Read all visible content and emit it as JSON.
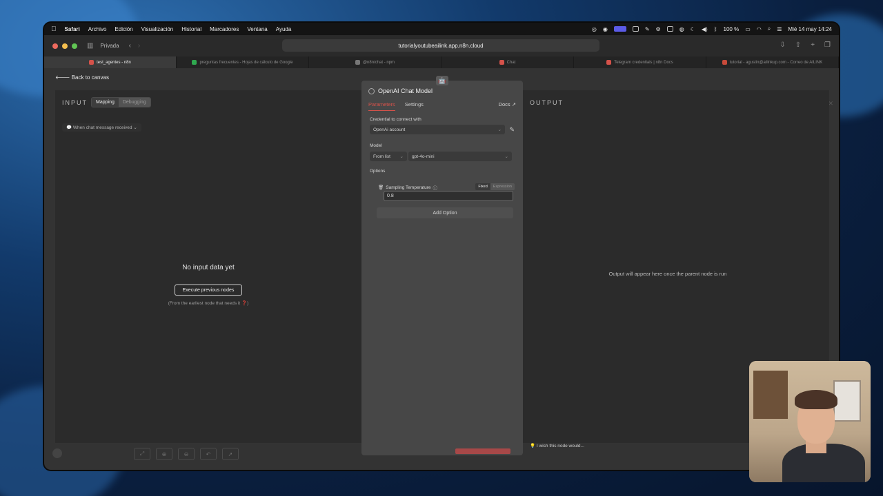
{
  "menubar": {
    "app": "Safari",
    "items": [
      "Archivo",
      "Edición",
      "Visualización",
      "Historial",
      "Marcadores",
      "Ventana",
      "Ayuda"
    ],
    "battery": "100 %",
    "clock": "Mié 14 may 14:24"
  },
  "browser": {
    "private_label": "Privada",
    "url": "tutorialyoutubeailink.app.n8n.cloud",
    "tabs": [
      {
        "label": "test_agentes - n8n",
        "active": true,
        "color": "#d5524a"
      },
      {
        "label": "preguntas frecuentes - Hojas de cálculo de Google",
        "active": false,
        "color": "#2fa84f"
      },
      {
        "label": "@n8n/chat - npm",
        "active": false,
        "color": "#777777"
      },
      {
        "label": "Chat",
        "active": false,
        "color": "#d5524a"
      },
      {
        "label": "Telegram credentials | n8n Docs",
        "active": false,
        "color": "#d5524a"
      },
      {
        "label": "tutorial - agustin@ailinkup.com - Correo de AILINK",
        "active": false,
        "color": "#c84a3a"
      }
    ]
  },
  "app": {
    "back_label": "Back to canvas",
    "input": {
      "title": "INPUT",
      "mapping_label": "Mapping",
      "debugging_label": "Debugging",
      "trigger_label": "When chat message received",
      "empty_title": "No input data yet",
      "execute_label": "Execute previous nodes",
      "hint": "(From the earliest node that needs it ❓)"
    },
    "output": {
      "title": "OUTPUT",
      "empty_message": "Output will appear here once the parent node is run",
      "wish_label": "I wish this node would..."
    },
    "node": {
      "title": "OpenAI Chat Model",
      "tab_parameters": "Parameters",
      "tab_settings": "Settings",
      "docs_label": "Docs ↗",
      "credential_label": "Credential to connect with",
      "credential_value": "OpenAi account",
      "model_label": "Model",
      "model_mode": "From list",
      "model_value": "gpt-4o-mini",
      "options_label": "Options",
      "sampling_label": "Sampling Temperature",
      "fixed_label": "Fixed",
      "expression_label": "Expression",
      "temperature_value": "0.8",
      "add_option_label": "Add Option"
    }
  },
  "colors": {
    "accent": "#d5524a",
    "panel_bg": "#2b2b2b",
    "node_bg": "#474747"
  }
}
